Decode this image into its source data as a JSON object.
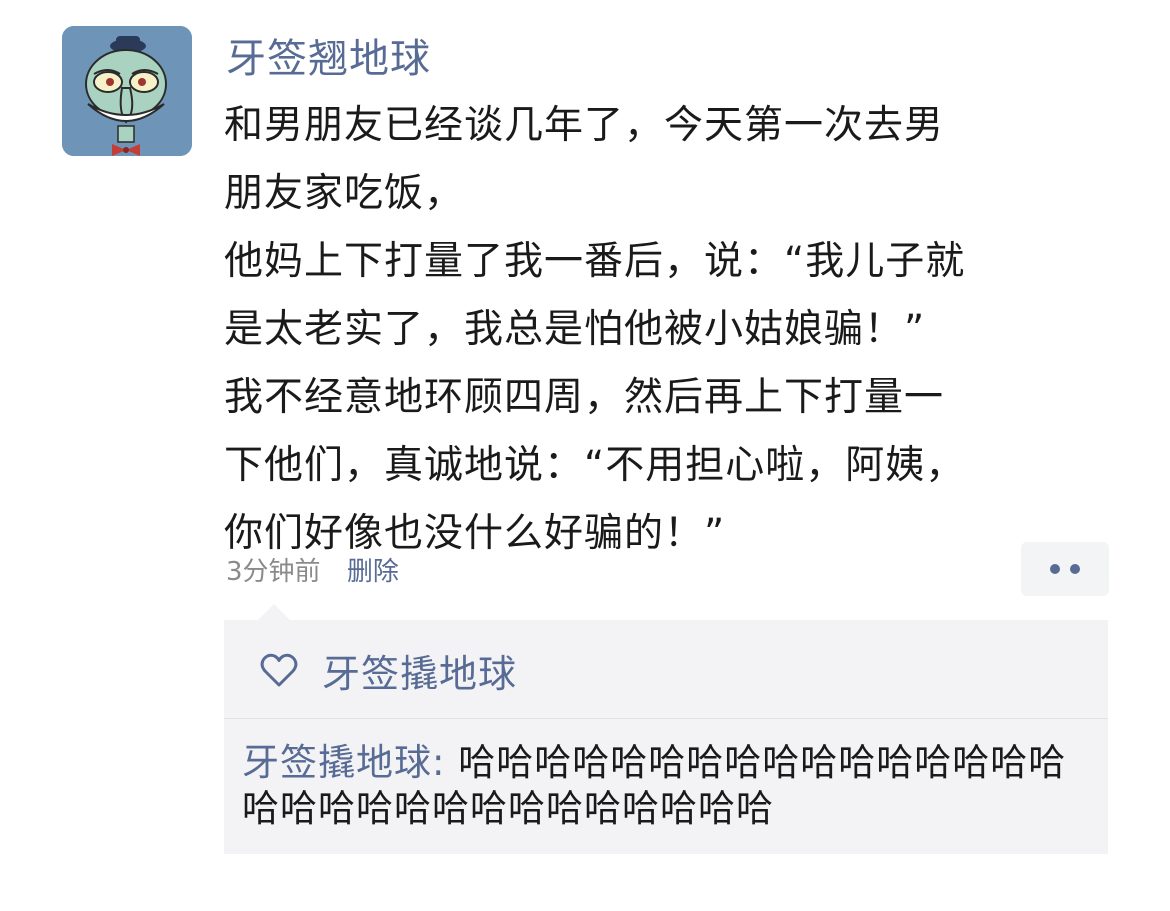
{
  "post": {
    "author": "牙签翘地球",
    "body_lines": [
      "和男朋友已经谈几年了，今天第一次去男",
      "朋友家吃饭，",
      "他妈上下打量了我一番后，说：“我儿子就",
      "是太老实了，我总是怕他被小姑娘骗！”",
      "我不经意地环顾四周，然后再上下打量一",
      "下他们，真诚地说：“不用担心啦，阿姨，",
      "你们好像也没什么好骗的！”"
    ],
    "timestamp": "3分钟前",
    "delete_label": "删除"
  },
  "interactions": {
    "liker": "牙签撬地球",
    "comment": {
      "author": "牙签撬地球",
      "separator": ": ",
      "text": "哈哈哈哈哈哈哈哈哈哈哈哈哈哈哈哈哈哈哈哈哈哈哈哈哈哈哈哈哈哈"
    }
  },
  "colors": {
    "link": "#576b95",
    "panel": "#f3f3f5",
    "avatar_bg": "#6e95b8"
  },
  "icons": {
    "avatar": "squidward-avatar",
    "more": "more-dots-icon",
    "like": "heart-outline-icon"
  }
}
